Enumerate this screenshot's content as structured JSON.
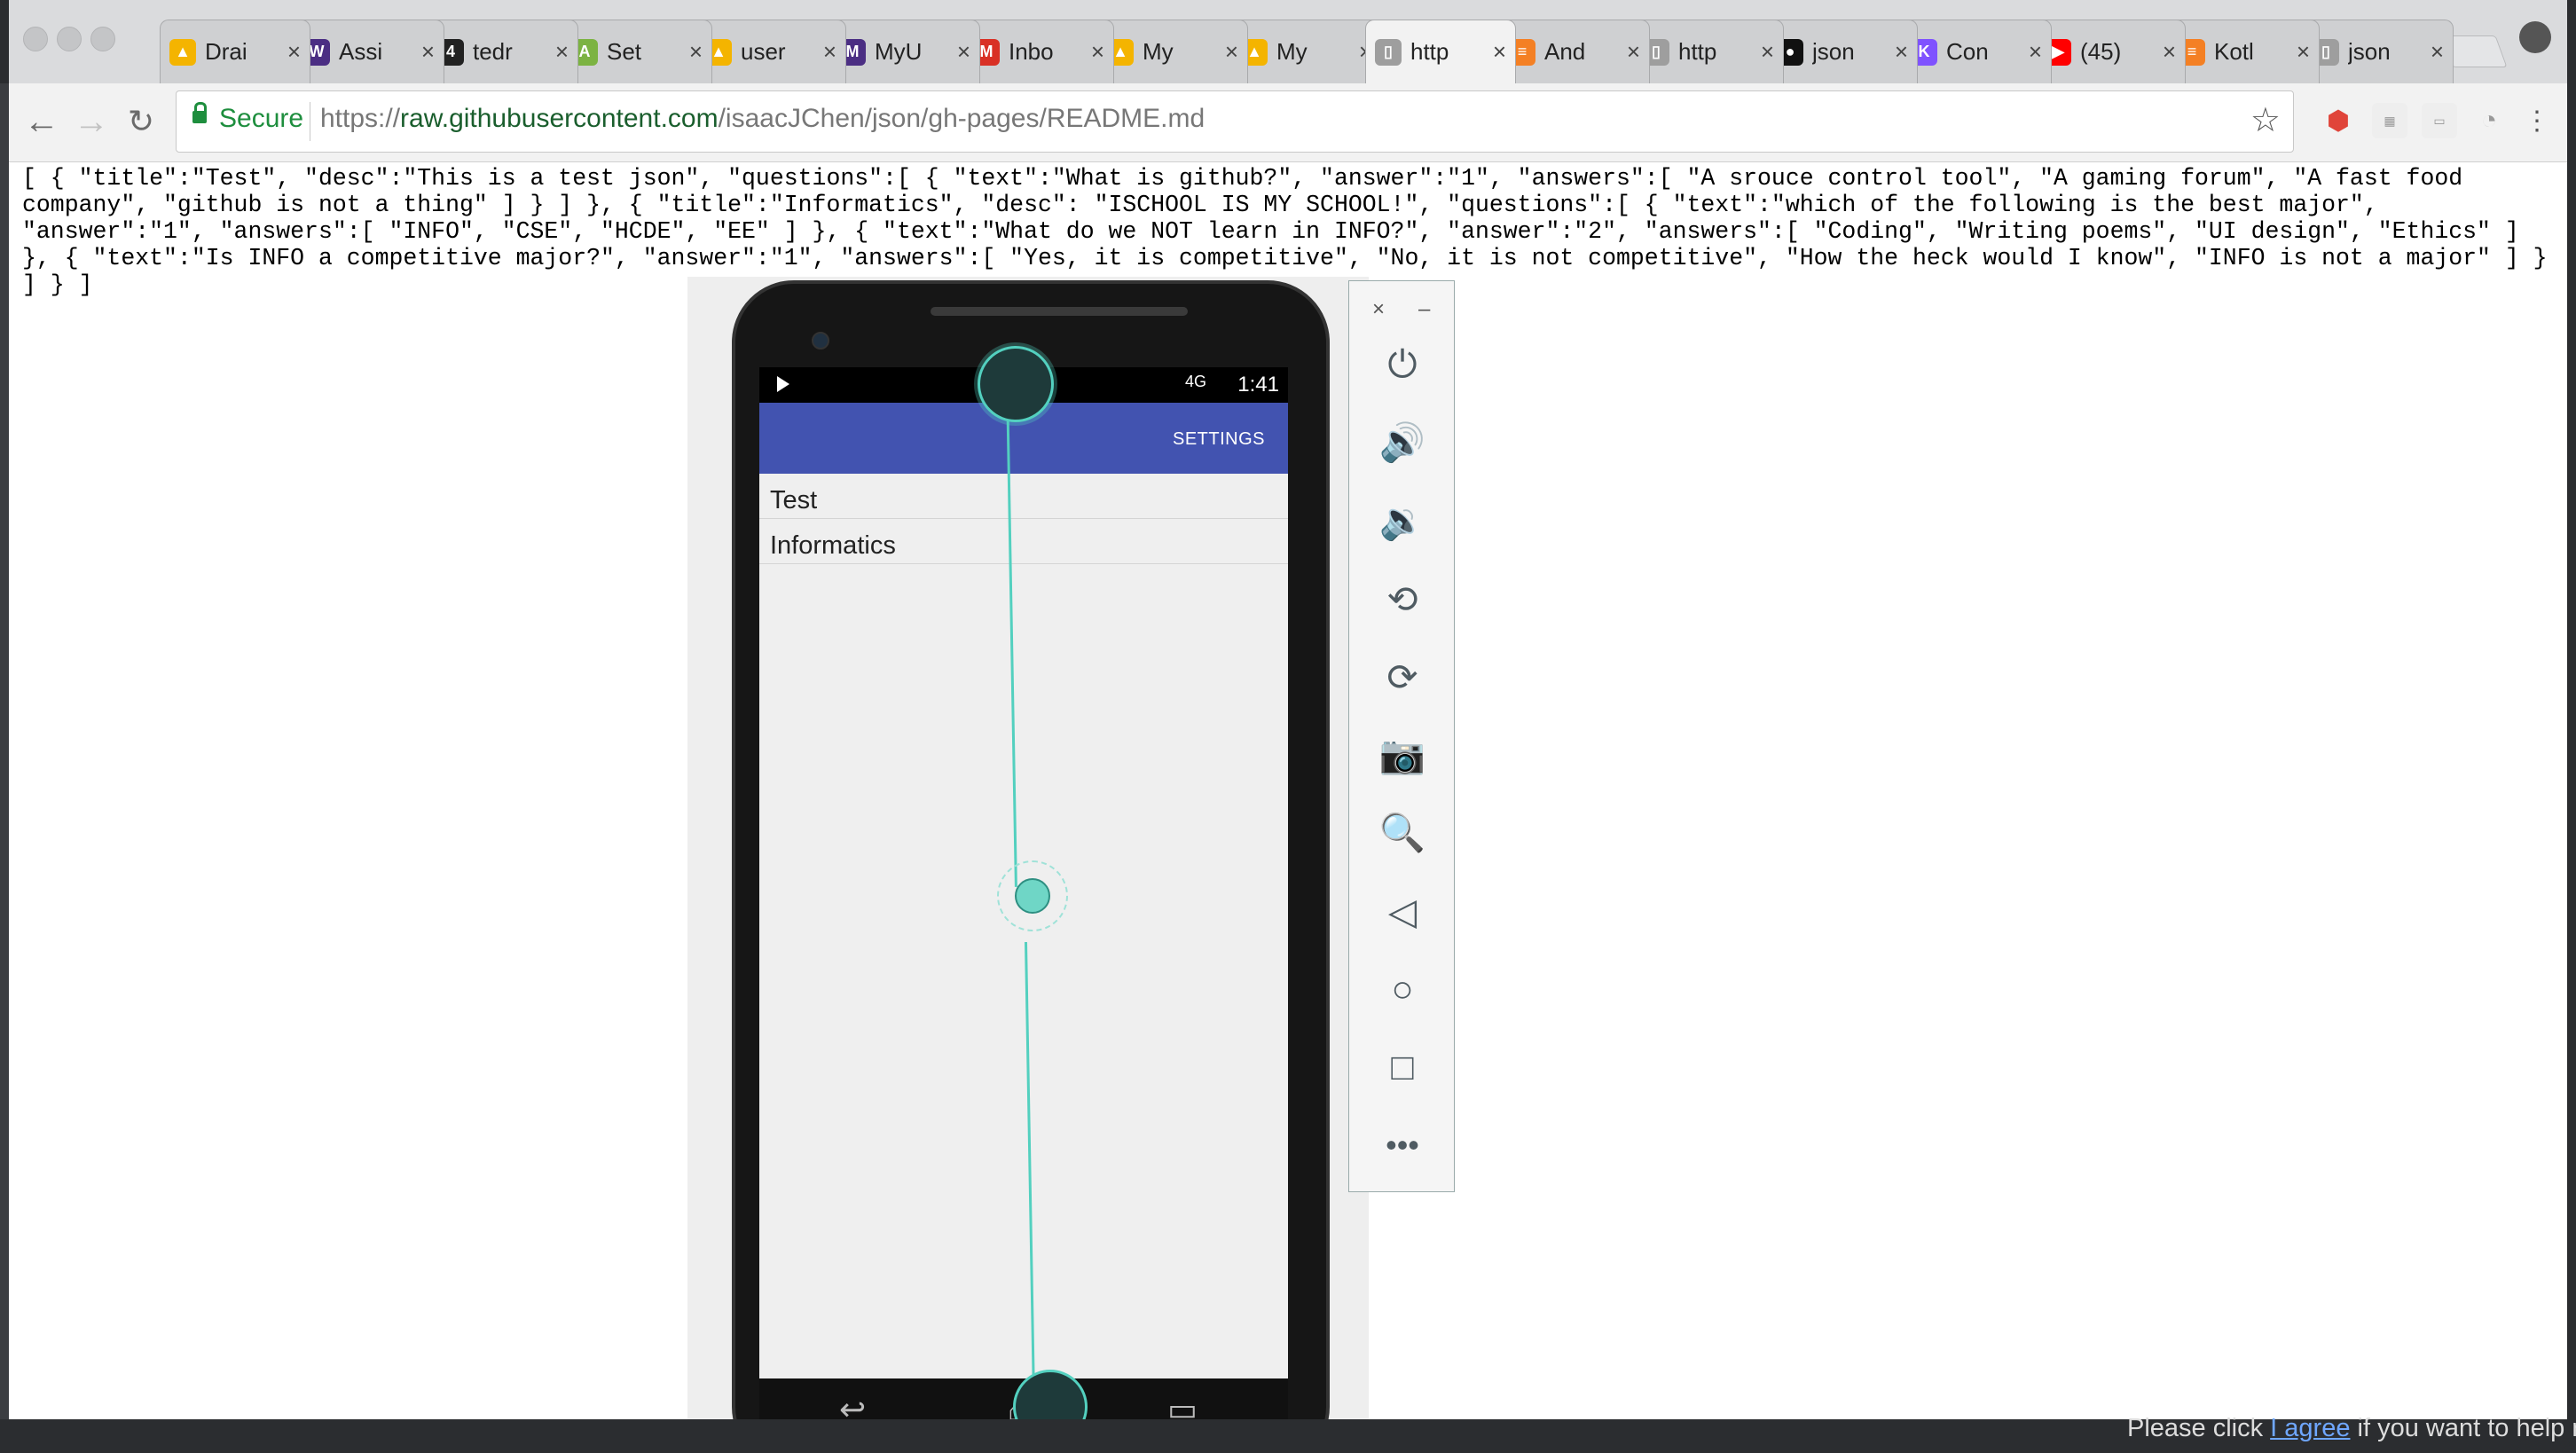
{
  "browser": {
    "tabs": [
      {
        "title": "Drai",
        "icon": "google-drive-icon",
        "color": "#f4b400"
      },
      {
        "title": "Assi",
        "icon": "uw-icon",
        "color": "#4b2e83"
      },
      {
        "title": "tedr",
        "icon": "tedr-icon",
        "color": "#222222"
      },
      {
        "title": "Set",
        "icon": "android-icon",
        "color": "#7cb342"
      },
      {
        "title": "user",
        "icon": "google-drive-icon",
        "color": "#f4b400"
      },
      {
        "title": "MyU",
        "icon": "myuw-icon",
        "color": "#4b2e83"
      },
      {
        "title": "Inbo",
        "icon": "gmail-icon",
        "color": "#d93025"
      },
      {
        "title": "My",
        "icon": "google-drive-icon",
        "color": "#f4b400"
      },
      {
        "title": "My",
        "icon": "google-drive-icon",
        "color": "#f4b400"
      },
      {
        "title": "http",
        "icon": "page-icon",
        "color": "#9e9e9e"
      },
      {
        "title": "And",
        "icon": "stackoverflow-icon",
        "color": "#f48024"
      },
      {
        "title": "http",
        "icon": "page-icon",
        "color": "#9e9e9e"
      },
      {
        "title": "json",
        "icon": "github-icon",
        "color": "#111111"
      },
      {
        "title": "Con",
        "icon": "kotlin-icon",
        "color": "#7f52ff"
      },
      {
        "title": "(45)",
        "icon": "youtube-icon",
        "color": "#ff0000"
      },
      {
        "title": "Kotl",
        "icon": "stackoverflow-icon",
        "color": "#f48024"
      },
      {
        "title": "json",
        "icon": "page-icon",
        "color": "#9e9e9e"
      }
    ],
    "active_tab_index": 9,
    "secure_label": "Secure",
    "url_scheme": "https://",
    "url_host": "raw.githubusercontent.com",
    "url_path": "/isaacJChen/json/gh-pages/README.md"
  },
  "raw_text": "[ { \"title\":\"Test\", \"desc\":\"This is a test json\", \"questions\":[ { \"text\":\"What is github?\", \"answer\":\"1\", \"answers\":[ \"A srouce control tool\", \"A gaming forum\", \"A fast food company\", \"github is not a thing\" ] } ] }, { \"title\":\"Informatics\", \"desc\": \"ISCHOOL IS MY SCHOOL!\", \"questions\":[ { \"text\":\"which of the following is the best major\", \"answer\":\"1\", \"answers\":[ \"INFO\", \"CSE\", \"HCDE\", \"EE\" ] }, { \"text\":\"What do we NOT learn in INFO?\", \"answer\":\"2\", \"answers\":[ \"Coding\", \"Writing poems\", \"UI design\", \"Ethics\" ] }, { \"text\":\"Is INFO a competitive major?\", \"answer\":\"1\", \"answers\":[ \"Yes, it is competitive\", \"No, it is not competitive\", \"How the heck would I know\", \"INFO is not a major\" ] } ] } ]",
  "emulator": {
    "status_signal": "4G",
    "status_time": "1:41",
    "appbar_action": "SETTINGS",
    "list_items": [
      "Test",
      "Informatics"
    ],
    "panel_buttons": [
      "power-icon",
      "volume-up-icon",
      "volume-down-icon",
      "rotate-left-icon",
      "rotate-right-icon",
      "camera-icon",
      "zoom-icon",
      "back-icon",
      "home-icon",
      "overview-icon",
      "more-icon"
    ],
    "close_glyph": "×",
    "minimize_glyph": "–"
  },
  "notice": {
    "prefix": "Please click ",
    "link": "I agree",
    "suffix": " if you want to help m"
  },
  "colors": {
    "accent_appbar": "#4253b0",
    "secure_green": "#1e8e3e",
    "touch_teal": "#53d0bf"
  }
}
